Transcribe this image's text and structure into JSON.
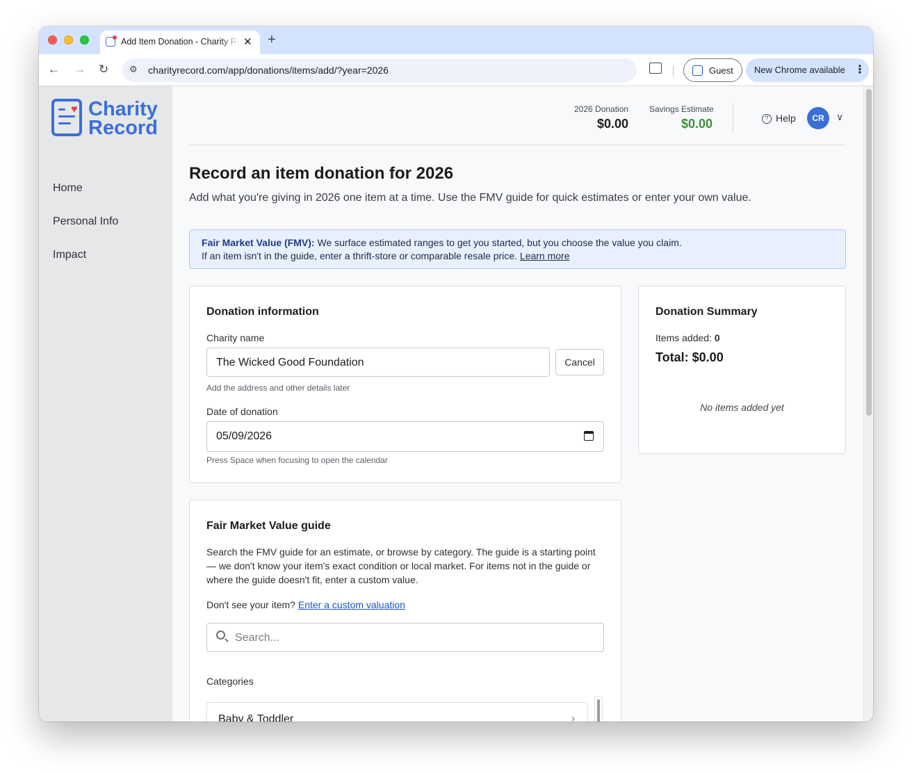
{
  "browser": {
    "tab_title": "Add Item Donation - Charity Record",
    "url": "charityrecord.com/app/donations/items/add/?year=2026",
    "profile_label": "Guest",
    "update_label": "New Chrome available"
  },
  "sidebar": {
    "logo_line1": "Charity",
    "logo_line2": "Record",
    "items": [
      {
        "label": "Home"
      },
      {
        "label": "Personal Info"
      },
      {
        "label": "Impact"
      }
    ]
  },
  "header": {
    "donation_label": "2026 Donation",
    "donation_value": "$0.00",
    "savings_label": "Savings Estimate",
    "savings_value": "$0.00",
    "help_label": "Help",
    "avatar_initials": "CR"
  },
  "page": {
    "title": "Record an item donation for 2026",
    "subtitle": "Add what you're giving in 2026 one item at a time. Use the FMV guide for quick estimates or enter your own value."
  },
  "fmv_banner": {
    "label": "Fair Market Value (FMV):",
    "line1": "We surface estimated ranges to get you started, but you choose the value you claim.",
    "line2": "If an item isn't in the guide, enter a thrift-store or comparable resale price.",
    "link": "Learn more"
  },
  "donation_info": {
    "title": "Donation information",
    "charity_label": "Charity name",
    "charity_value": "The Wicked Good Foundation",
    "cancel_label": "Cancel",
    "charity_hint": "Add the address and other details later",
    "date_label": "Date of donation",
    "date_value": "05/09/2026",
    "date_hint": "Press Space when focusing to open the calendar"
  },
  "fmv_guide": {
    "title": "Fair Market Value guide",
    "description": "Search the FMV guide for an estimate, or browse by category. The guide is a starting point — we don't know your item's exact condition or local market. For items not in the guide or where the guide doesn't fit, enter a custom value.",
    "custom_prompt": "Don't see your item?",
    "custom_link": "Enter a custom valuation",
    "search_placeholder": "Search...",
    "categories_label": "Categories",
    "categories": [
      {
        "label": "Baby & Toddler"
      }
    ]
  },
  "summary": {
    "title": "Donation Summary",
    "items_label": "Items added:",
    "items_count": "0",
    "total_label": "Total: $0.00",
    "empty_text": "No items added yet"
  },
  "colors": {
    "brand": "#3b6fd8",
    "savings": "#3f8f3a",
    "banner_bg": "#e8f0fe"
  }
}
